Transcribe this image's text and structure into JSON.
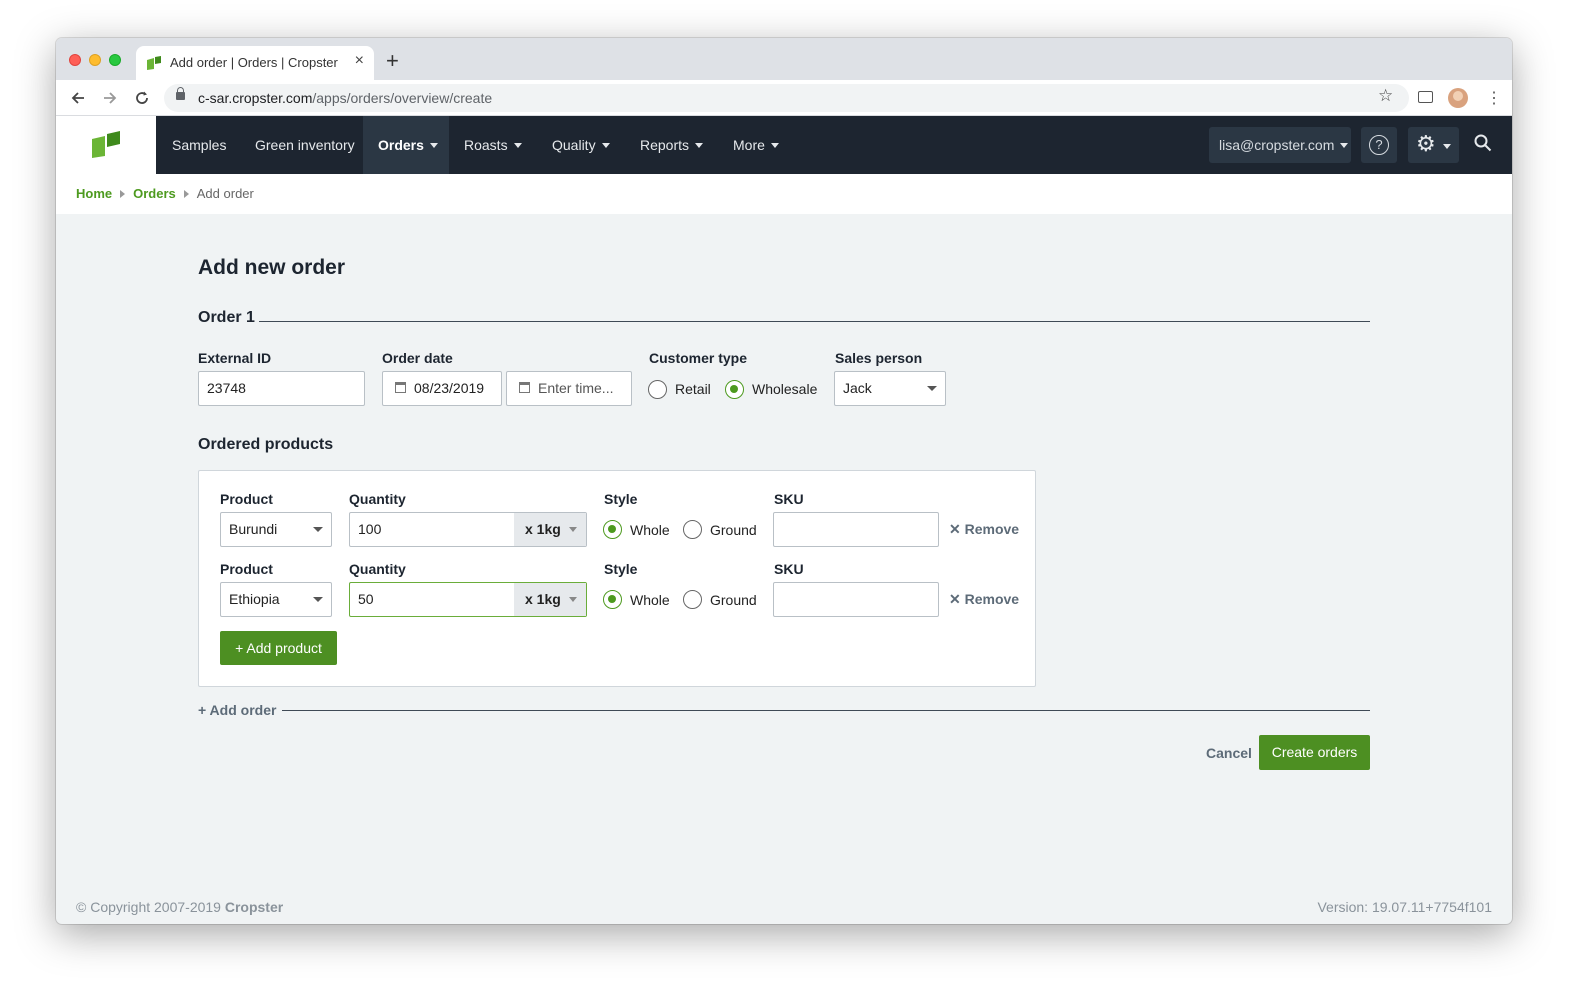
{
  "browser": {
    "tab_title": "Add order | Orders | Cropster",
    "tab_close": "×",
    "new_tab": "+",
    "url_host": "c-sar.cropster.com",
    "url_path": "/apps/orders/overview/create",
    "star": "☆",
    "menu": "⋮"
  },
  "nav": {
    "items": [
      {
        "label": "Samples",
        "dropdown": false
      },
      {
        "label": "Green inventory",
        "dropdown": false
      },
      {
        "label": "Orders",
        "dropdown": true,
        "active": true
      },
      {
        "label": "Roasts",
        "dropdown": true
      },
      {
        "label": "Quality",
        "dropdown": true
      },
      {
        "label": "Reports",
        "dropdown": true
      },
      {
        "label": "More",
        "dropdown": true
      }
    ],
    "user": "lisa@cropster.com",
    "help": "?",
    "gear": "⚙"
  },
  "breadcrumb": {
    "home": "Home",
    "orders": "Orders",
    "current": "Add order"
  },
  "page": {
    "title": "Add new order",
    "order_section": "Order 1"
  },
  "form": {
    "external_id_label": "External ID",
    "external_id_value": "23748",
    "order_date_label": "Order date",
    "order_date_value": "08/23/2019",
    "time_placeholder": "Enter time...",
    "customer_type_label": "Customer type",
    "customer_types": [
      "Retail",
      "Wholesale"
    ],
    "customer_type_selected": "Wholesale",
    "sales_person_label": "Sales person",
    "sales_person_value": "Jack"
  },
  "products": {
    "title": "Ordered products",
    "rows": [
      {
        "product_label": "Product",
        "product": "Burundi",
        "quantity_label": "Quantity",
        "quantity": "100",
        "unit": "x 1kg",
        "style_label": "Style",
        "styles": [
          "Whole",
          "Ground"
        ],
        "style_selected": "Whole",
        "sku_label": "SKU",
        "sku": "",
        "remove": "Remove"
      },
      {
        "product_label": "Product",
        "product": "Ethiopia",
        "quantity_label": "Quantity",
        "quantity": "50",
        "unit": "x 1kg",
        "style_label": "Style",
        "styles": [
          "Whole",
          "Ground"
        ],
        "style_selected": "Whole",
        "sku_label": "SKU",
        "sku": "",
        "remove": "Remove"
      }
    ],
    "add_product": "+ Add product"
  },
  "actions": {
    "add_order": "+ Add order",
    "cancel": "Cancel",
    "create": "Create orders"
  },
  "footer": {
    "copyright": "© Copyright 2007-2019",
    "brand": "Cropster",
    "version": "Version: 19.07.11+7754f101"
  },
  "colors": {
    "brand_green": "#4d8f22",
    "nav_bg": "#1d2530"
  }
}
